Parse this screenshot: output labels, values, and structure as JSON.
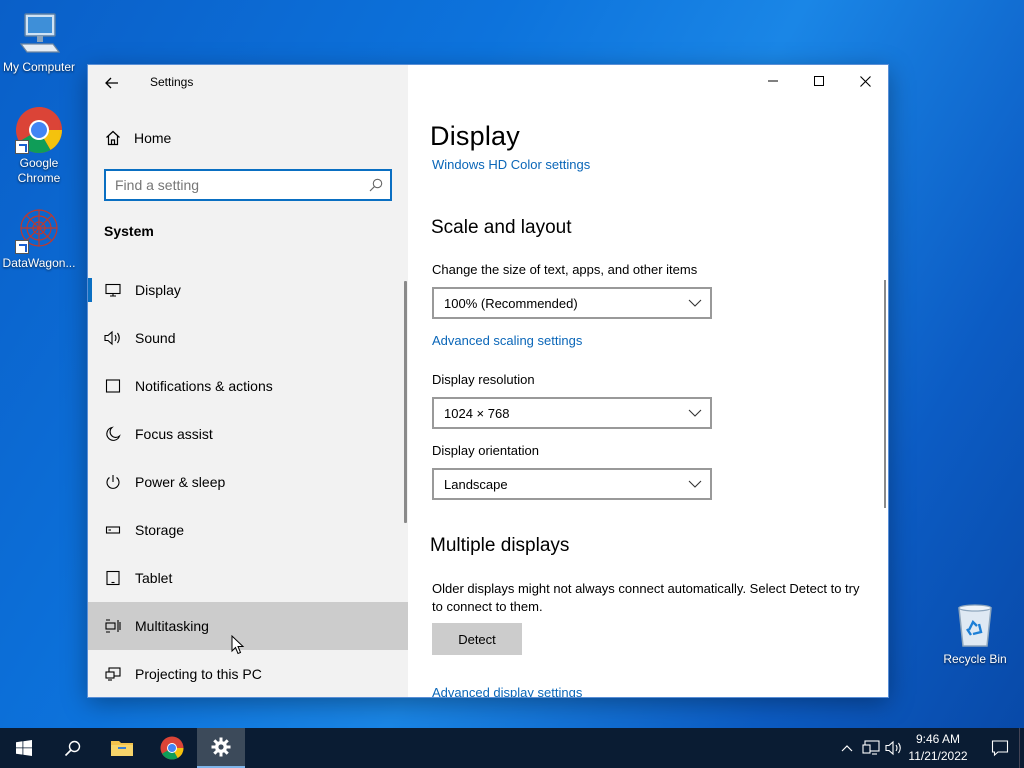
{
  "desktop": {
    "icons": [
      {
        "label": "My Computer"
      },
      {
        "label": "Google Chrome"
      },
      {
        "label": "DataWagon..."
      },
      {
        "label": "Recycle Bin"
      }
    ]
  },
  "window": {
    "title": "Settings",
    "back_icon": "arrow-left-icon",
    "caption_icons": [
      "minimize-icon",
      "maximize-icon",
      "close-icon"
    ]
  },
  "sidebar": {
    "home_label": "Home",
    "search_placeholder": "Find a setting",
    "section": "System",
    "items": [
      {
        "label": "Display",
        "icon": "monitor-icon"
      },
      {
        "label": "Sound",
        "icon": "speaker-icon"
      },
      {
        "label": "Notifications & actions",
        "icon": "notification-icon"
      },
      {
        "label": "Focus assist",
        "icon": "moon-icon"
      },
      {
        "label": "Power & sleep",
        "icon": "power-icon"
      },
      {
        "label": "Storage",
        "icon": "storage-icon"
      },
      {
        "label": "Tablet",
        "icon": "tablet-icon"
      },
      {
        "label": "Multitasking",
        "icon": "multitasking-icon"
      },
      {
        "label": "Projecting to this PC",
        "icon": "projector-icon"
      }
    ],
    "selected": "Display",
    "hovered": "Multitasking"
  },
  "content": {
    "title": "Display",
    "hd_color_link": "Windows HD Color settings",
    "scale_heading": "Scale and layout",
    "scale_label": "Change the size of text, apps, and other items",
    "scale_value": "100% (Recommended)",
    "advanced_scaling_link": "Advanced scaling settings",
    "resolution_label": "Display resolution",
    "resolution_value": "1024 × 768",
    "orientation_label": "Display orientation",
    "orientation_value": "Landscape",
    "multi_heading": "Multiple displays",
    "multi_desc": "Older displays might not always connect automatically. Select Detect to try to connect to them.",
    "detect_label": "Detect",
    "advanced_display_link": "Advanced display settings"
  },
  "taskbar": {
    "time": "9:46 AM",
    "date": "11/21/2022"
  },
  "colors": {
    "accent": "#0a6fc2",
    "link": "#0a66b8",
    "taskbar": "#0a1c33"
  }
}
